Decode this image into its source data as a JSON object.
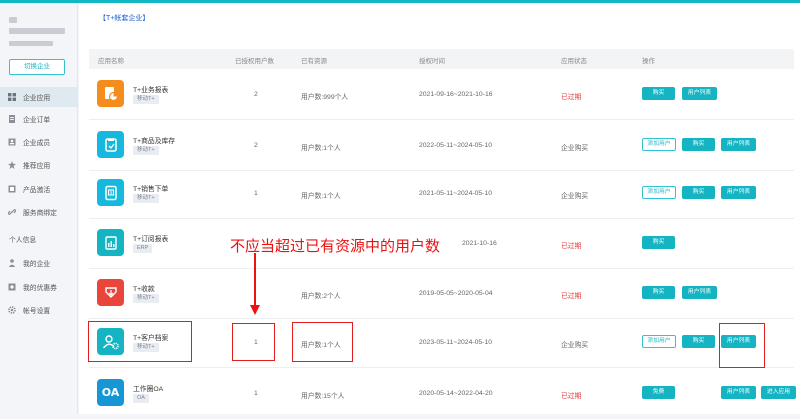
{
  "sidebar": {
    "switch_label": "切换企业",
    "items": [
      {
        "label": "企业应用",
        "icon": "grid-icon"
      },
      {
        "label": "企业订单",
        "icon": "order-icon"
      },
      {
        "label": "企业成员",
        "icon": "member-icon"
      },
      {
        "label": "推荐应用",
        "icon": "star-icon"
      },
      {
        "label": "产品激活",
        "icon": "activate-icon"
      },
      {
        "label": "服务商绑定",
        "icon": "link-icon"
      }
    ],
    "section_label": "个人信息",
    "personal_items": [
      {
        "label": "我的企业",
        "icon": "person-icon"
      },
      {
        "label": "我的优惠券",
        "icon": "coupon-icon"
      },
      {
        "label": "帐号设置",
        "icon": "gear-icon"
      }
    ]
  },
  "page": {
    "title": "【T+帐套企业】"
  },
  "table": {
    "headers": [
      "应用名称",
      "已授权用户数",
      "已有资源",
      "授权时间",
      "应用状态",
      "操作"
    ],
    "rows": [
      {
        "name": "T+业务报表",
        "tag": "移动T+",
        "users": "2",
        "resource": "用户数:999个人",
        "time": "2021-09-16~2021-10-16",
        "status": "已过期",
        "buttons": [
          "购买",
          "用户列表"
        ]
      },
      {
        "name": "T+商品及库存",
        "tag": "移动T+",
        "users": "2",
        "resource": "用户数:1个人",
        "time": "2022-05-11~2024-05-10",
        "status": "企业购买",
        "buttons": [
          "添加用户",
          "购买",
          "用户列表"
        ]
      },
      {
        "name": "T+销售下单",
        "tag": "移动T+",
        "users": "1",
        "resource": "用户数:1个人",
        "time": "2021-05-11~2024-05-10",
        "status": "企业购买",
        "buttons": [
          "添加用户",
          "购买",
          "用户列表"
        ]
      },
      {
        "name": "T+订阅报表",
        "tag": "ERP",
        "users": "",
        "resource": "",
        "time": "2021-10-16",
        "status": "已过期",
        "buttons": [
          "购买"
        ]
      },
      {
        "name": "T+收款",
        "tag": "移动T+",
        "users": "",
        "resource": "用户数:2个人",
        "time": "2019-05-05~2020-05-04",
        "status": "已过期",
        "buttons": [
          "购买",
          "用户列表"
        ]
      },
      {
        "name": "T+客户档案",
        "tag": "移动T+",
        "users": "1",
        "resource": "用户数:1个人",
        "time": "2023-05-11~2024-05-10",
        "status": "企业购买",
        "buttons": [
          "添加用户",
          "购买",
          "用户列表"
        ]
      },
      {
        "name": "工作圈OA",
        "tag": "OA",
        "users": "1",
        "resource": "用户数:15个人",
        "time": "2020-05-14~2022-04-20",
        "status": "已过期",
        "buttons": [
          "免费",
          "用户列表",
          "进入应用"
        ]
      }
    ]
  },
  "annotation": {
    "text": "不应当超过已有资源中的用户数"
  },
  "icons": {
    "oa_text": "OA"
  },
  "colors": {
    "accent": "#14b4c3",
    "expired": "#e33b3b",
    "annotation": "#e21d1d"
  }
}
